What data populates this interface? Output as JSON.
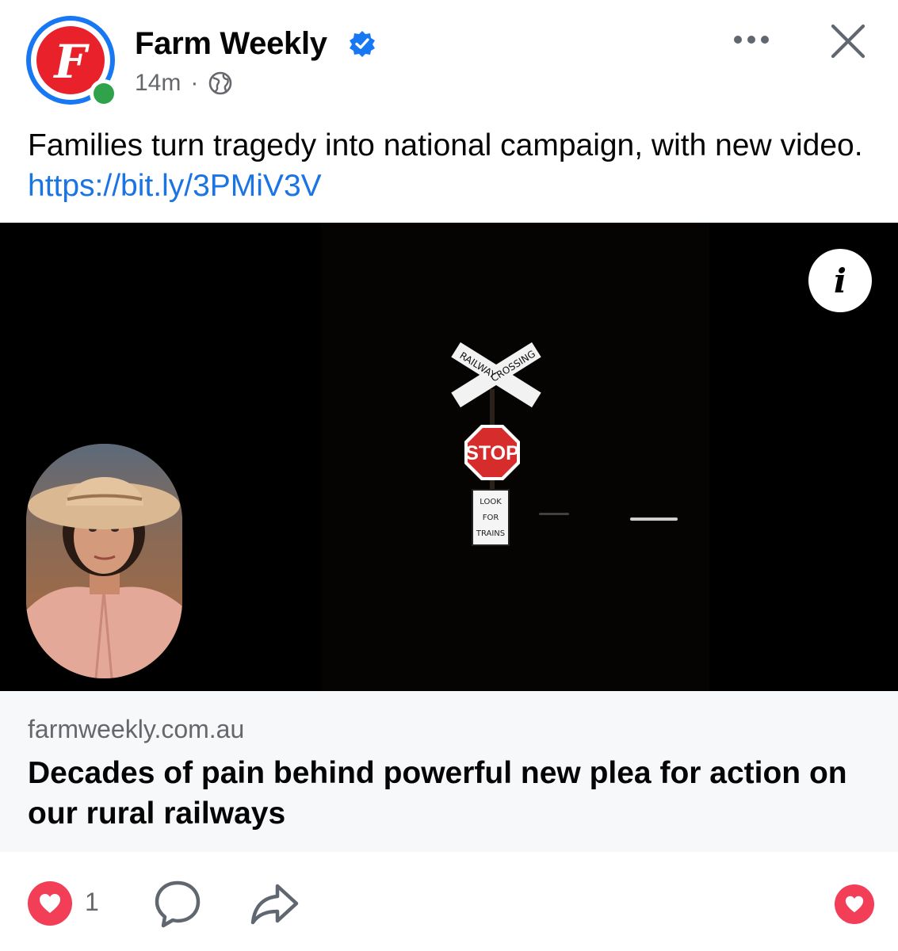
{
  "post": {
    "page_name": "Farm Weekly",
    "timestamp": "14m",
    "separator": "·",
    "audience_icon": "globe-icon",
    "caption_text": "Families turn tragedy into national campaign, with new video. ",
    "caption_link": "https://bit.ly/3PMiV3V",
    "logo_letter": "F"
  },
  "media": {
    "info_label": "i",
    "sign_top_left": "RAILWAY",
    "sign_top_right": "CROSSING",
    "stop_sign": "STOP",
    "look_sign": [
      "LOOK",
      "FOR",
      "TRAINS"
    ]
  },
  "link_preview": {
    "domain": "farmweekly.com.au",
    "headline": "Decades of pain behind powerful new plea for action on our rural railways"
  },
  "footer": {
    "reaction_count": "1"
  },
  "colors": {
    "brand_blue": "#1877f2",
    "link_blue": "#1b74e4",
    "love_red": "#f33e58",
    "online_green": "#31a24c",
    "logo_red": "#e8212b",
    "secondary_text": "#65676b"
  }
}
